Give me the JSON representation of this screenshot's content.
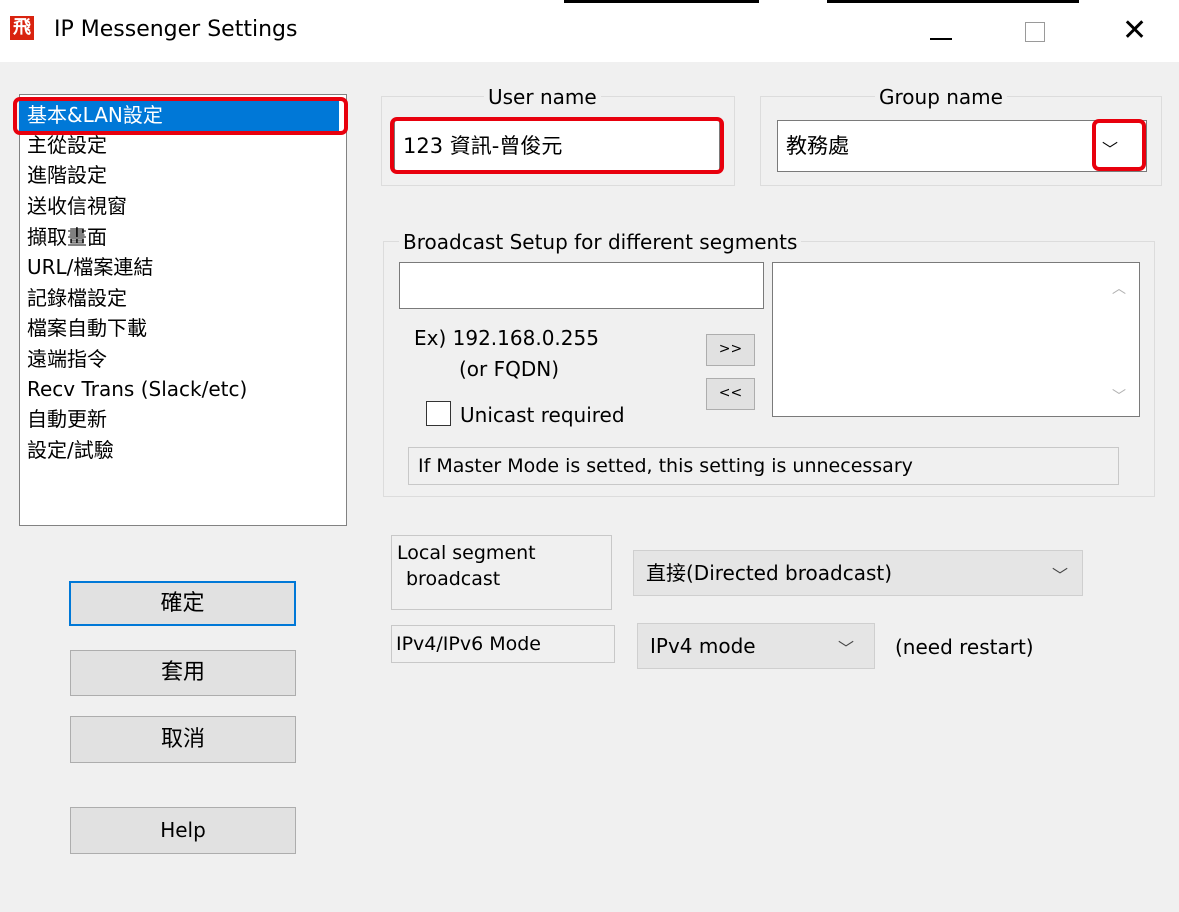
{
  "window": {
    "title": "IP Messenger Settings",
    "app_icon_glyph": "飛",
    "close_glyph": "✕"
  },
  "nav": {
    "items": [
      {
        "label": "基本&LAN設定",
        "selected": true
      },
      {
        "label": "主從設定"
      },
      {
        "label": "進階設定"
      },
      {
        "label": "送收信視窗"
      },
      {
        "label": "擷取畫面"
      },
      {
        "label": "URL/檔案連結"
      },
      {
        "label": "記錄檔設定"
      },
      {
        "label": "檔案自動下載"
      },
      {
        "label": "遠端指令"
      },
      {
        "label": "Recv Trans (Slack/etc)"
      },
      {
        "label": "自動更新"
      },
      {
        "label": "設定/試驗"
      }
    ]
  },
  "buttons": {
    "ok": "確定",
    "apply": "套用",
    "cancel": "取消",
    "help": "Help"
  },
  "user": {
    "legend": "User name",
    "value": "123 資訊-曾俊元"
  },
  "group": {
    "legend": "Group name",
    "value": "教務處",
    "arrow": "﹀"
  },
  "broadcast": {
    "legend": "Broadcast Setup for different segments",
    "input_value": "",
    "example_line1": "Ex) 192.168.0.255",
    "example_line2": "(or FQDN)",
    "add_button": ">>",
    "remove_button": "<<",
    "unicast_label": "Unicast required",
    "unicast_checked": false,
    "note": "If Master Mode is setted, this setting is unnecessary"
  },
  "local_segment": {
    "label_line1": "Local segment",
    "label_line2": "broadcast",
    "selected": "直接(Directed broadcast)"
  },
  "ip_mode": {
    "label": "IPv4/IPv6 Mode",
    "selected": "IPv4 mode",
    "note": "(need restart)"
  },
  "colors": {
    "highlight_red": "#e8000d",
    "selection_blue": "#0078d7"
  }
}
